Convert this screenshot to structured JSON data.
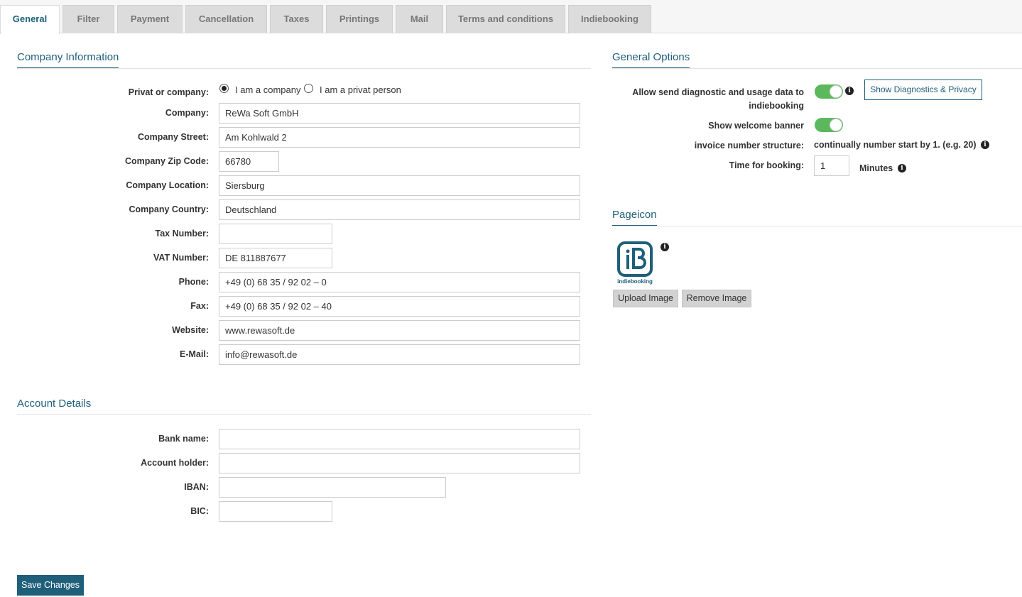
{
  "tabs": [
    {
      "label": "General",
      "active": true
    },
    {
      "label": "Filter"
    },
    {
      "label": "Payment"
    },
    {
      "label": "Cancellation"
    },
    {
      "label": "Taxes"
    },
    {
      "label": "Printings"
    },
    {
      "label": "Mail"
    },
    {
      "label": "Terms and conditions"
    },
    {
      "label": "Indiebooking"
    }
  ],
  "company": {
    "title": "Company Information",
    "privat_label": "Privat or company:",
    "radio_company": "I am a company",
    "radio_private": "I am a privat person",
    "selected": "company",
    "fields": {
      "company": {
        "label": "Company:",
        "value": "ReWa Soft GmbH"
      },
      "street": {
        "label": "Company Street:",
        "value": "Am Kohlwald 2"
      },
      "zip": {
        "label": "Company Zip Code:",
        "value": "66780"
      },
      "location": {
        "label": "Company Location:",
        "value": "Siersburg"
      },
      "country": {
        "label": "Company Country:",
        "value": "Deutschland"
      },
      "tax": {
        "label": "Tax Number:",
        "value": ""
      },
      "vat": {
        "label": "VAT Number:",
        "value": "DE 811887677"
      },
      "phone": {
        "label": "Phone:",
        "value": "+49 (0) 68 35 / 92 02 – 0"
      },
      "fax": {
        "label": "Fax:",
        "value": "+49 (0) 68 35 / 92 02 – 40"
      },
      "website": {
        "label": "Website:",
        "value": "www.rewasoft.de"
      },
      "email": {
        "label": "E-Mail:",
        "value": "info@rewasoft.de"
      }
    }
  },
  "account": {
    "title": "Account Details",
    "fields": {
      "bank": {
        "label": "Bank name:",
        "value": ""
      },
      "holder": {
        "label": "Account holder:",
        "value": ""
      },
      "iban": {
        "label": "IBAN:",
        "value": ""
      },
      "bic": {
        "label": "BIC:",
        "value": ""
      }
    }
  },
  "options": {
    "title": "General Options",
    "diag_label_1": "Allow send diagnostic and usage data to",
    "diag_label_2": "indiebooking",
    "diag_enabled": true,
    "diag_button": "Show Diagnostics & Privacy",
    "welcome_label": "Show welcome banner",
    "welcome_enabled": true,
    "invoice_label": "invoice number structure:",
    "invoice_value": "continually number start by 1. (e.g. 20)",
    "booking_label": "Time for booking:",
    "booking_value": "1",
    "booking_unit": "Minutes"
  },
  "pageicon": {
    "title": "Pageicon",
    "logo_text": "indiebooking",
    "upload_button": "Upload Image",
    "remove_button": "Remove Image"
  },
  "save_button": "Save Changes",
  "colors": {
    "accent": "#1f5f7a",
    "toggle_on": "#5cb85c"
  }
}
